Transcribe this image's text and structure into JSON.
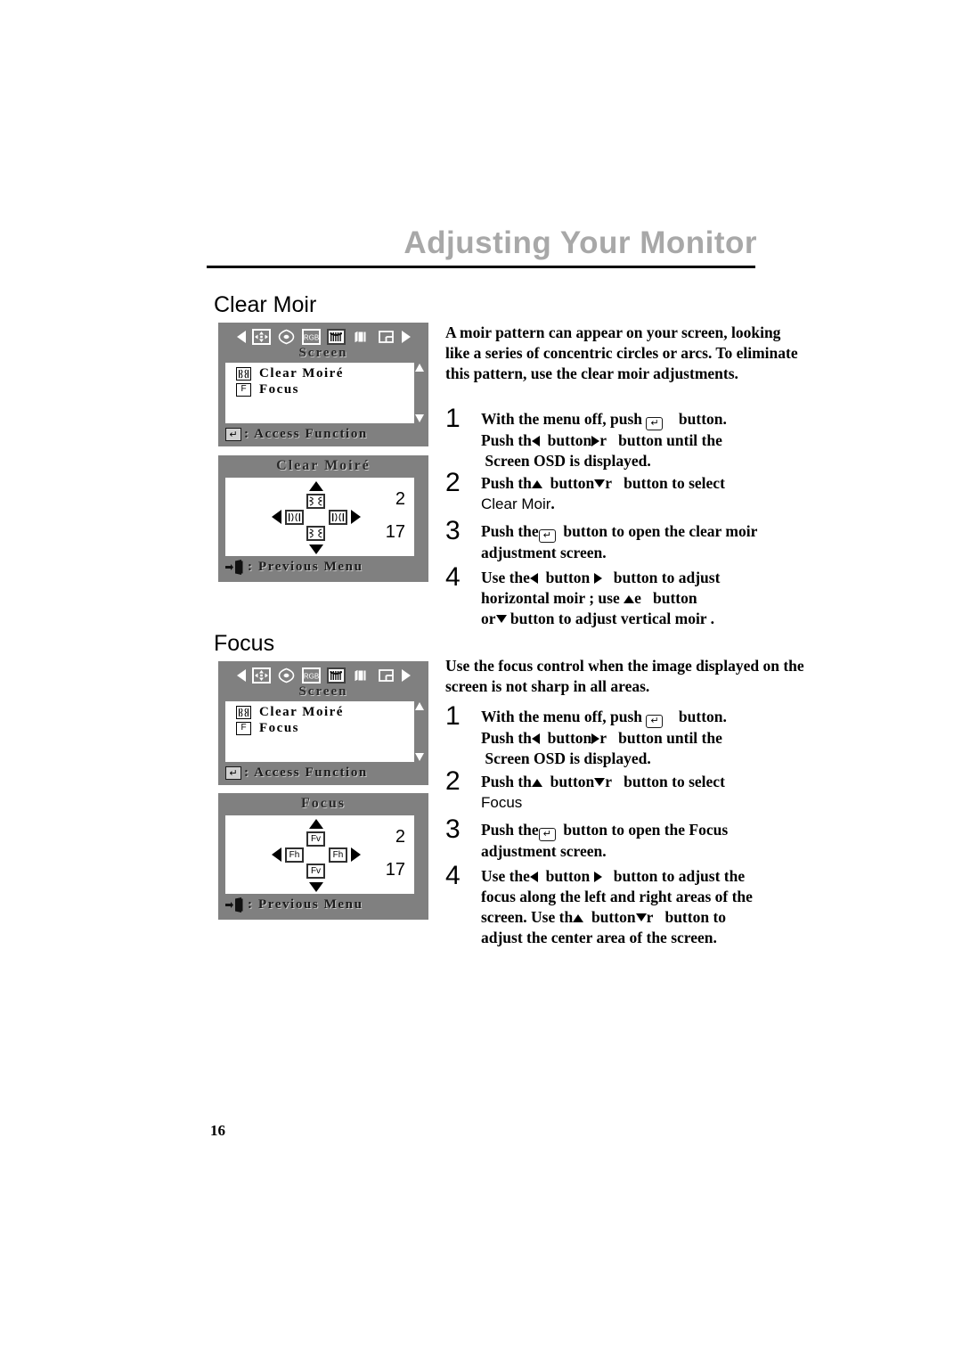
{
  "page": {
    "title": "Adjusting Your Monitor",
    "number": "16",
    "title_color": "#a8a8a8"
  },
  "sections": [
    {
      "heading": "Clear Moir",
      "intro": "A  moir   pattern can appear on your screen, looking like a series of concentric circles or arcs. To eliminate this pattern, use the clear moir  adjustments.",
      "steps": [
        {
          "num": "1",
          "line1_a": "With the menu off, push",
          "line1_b": "button.",
          "line2_a": "Push th",
          "line2_b": "button",
          "line2_c": "r",
          "line2_d": "button until the",
          "line3": "Screen  OSD is displayed."
        },
        {
          "num": "2",
          "line1_a": "Push th",
          "line1_b": "button",
          "line1_c": "r",
          "line1_d": "button to select",
          "line2_sans": "Clear Moir",
          "line2_tail": "."
        },
        {
          "num": "3",
          "line1_a": "Push the",
          "line1_b": "button to open the clear moir",
          "line2": "adjustment screen."
        },
        {
          "num": "4",
          "line1_a": "Use the",
          "line1_b": "button",
          "line1_c": "button to adjust",
          "line2_a": "horizontal moir ; use",
          "line2_b": "e",
          "line2_c": "button",
          "line3_a": "or",
          "line3_b": "button to adjust vertical moir ."
        }
      ]
    },
    {
      "heading": "Focus",
      "intro": "Use the focus control when the image displayed on the screen is not sharp in all areas.",
      "steps": [
        {
          "num": "1",
          "line1_a": "With the menu off, push",
          "line1_b": "button.",
          "line2_a": "Push th",
          "line2_b": "button",
          "line2_c": "r",
          "line2_d": "button until the",
          "line3": "Screen  OSD is displayed."
        },
        {
          "num": "2",
          "line1_a": "Push th",
          "line1_b": "button",
          "line1_c": "r",
          "line1_d": "button to select",
          "line2_sans": "Focus",
          "line2_tail": ""
        },
        {
          "num": "3",
          "line1_a": "Push the",
          "line1_b": "button to open the Focus",
          "line2": "adjustment screen."
        },
        {
          "num": "4",
          "line1_a": "Use the",
          "line1_b": "button",
          "line1_c": "button to adjust the",
          "line2": "focus along the left and right areas of the",
          "line3_a": "screen. Use th",
          "line3_b": "button",
          "line3_c": "r",
          "line3_d": "button to",
          "line4": "adjust the center area of the screen."
        }
      ]
    }
  ],
  "osd": {
    "background": "#808080",
    "menu": {
      "caption": "Screen",
      "icons": [
        "nav-left-arrow",
        "position-icon",
        "geometry-icon",
        "rgb-icon",
        "screen-icon",
        "pages-icon",
        "osd-layout-icon",
        "nav-right-arrow"
      ],
      "selected_icon": "screen-icon",
      "items": [
        {
          "icon": "moire-icon",
          "icon_label": "",
          "label": "Clear Moiré"
        },
        {
          "icon": "focus-icon",
          "icon_label": "F",
          "label": "Focus"
        }
      ],
      "footer": {
        "icon": "enter-key-icon",
        "glyph": "↵",
        "label": ": Access Function"
      }
    },
    "adjust_moire": {
      "title": "Clear Moiré",
      "box_up": "",
      "box_down": "",
      "box_left": "",
      "box_right": "",
      "value_top": "2",
      "value_bottom": "17",
      "footer": {
        "icon": "exit-door-icon",
        "label": ": Previous Menu"
      }
    },
    "adjust_focus": {
      "title": "Focus",
      "box_up": "Fv",
      "box_down": "Fv",
      "box_left": "Fh",
      "box_right": "Fh",
      "value_top": "2",
      "value_bottom": "17",
      "footer": {
        "icon": "exit-door-icon",
        "label": ": Previous Menu"
      }
    }
  }
}
